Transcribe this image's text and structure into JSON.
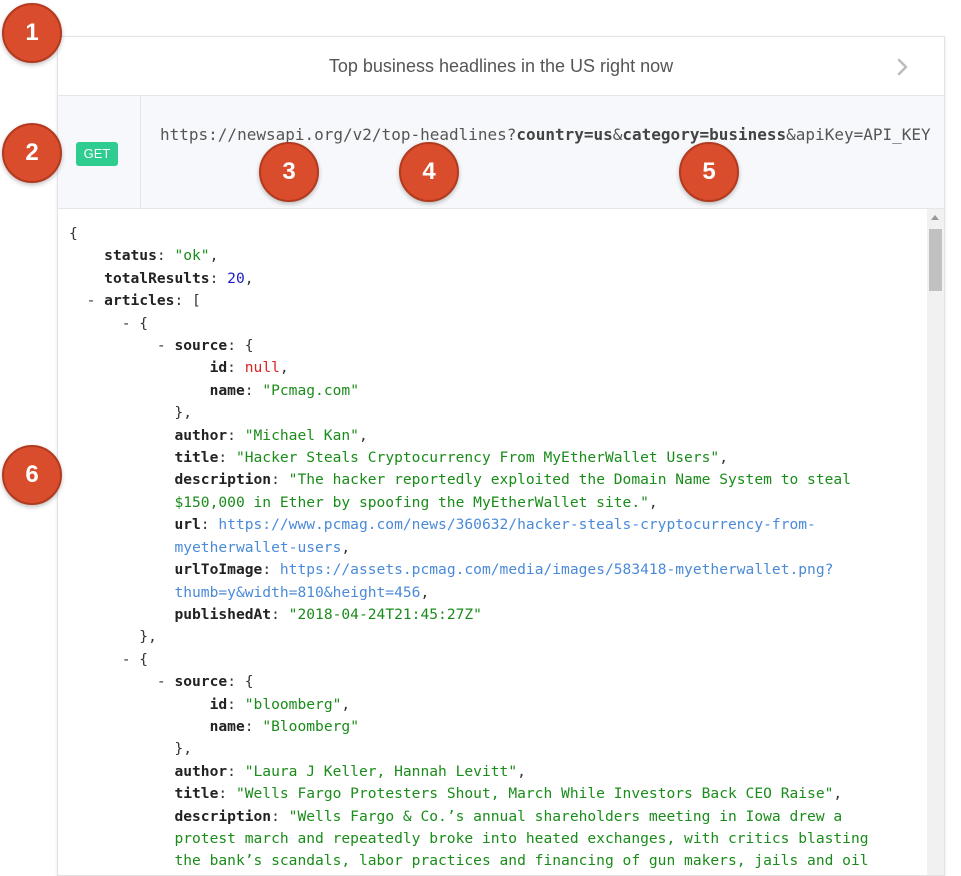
{
  "header": {
    "title": "Top business headlines in the US right now"
  },
  "request": {
    "method": "GET",
    "url_prefix": "https://newsapi.org/v2/top-headlines?",
    "param1": "country=us",
    "amp1": "&",
    "param2": "category=business",
    "url_suffix": "&apiKey=API_KEY"
  },
  "markers": [
    "1",
    "2",
    "3",
    "4",
    "5",
    "6"
  ],
  "json": {
    "open_brace": "{",
    "status_key": "status",
    "status_val": "\"ok\"",
    "total_key": "totalResults",
    "total_val": "20",
    "articles_key": "articles",
    "collapse": "-",
    "a1": {
      "source_key": "source",
      "id_key": "id",
      "id_val": "null",
      "name_key": "name",
      "name_val": "\"Pcmag.com\"",
      "author_key": "author",
      "author_val": "\"Michael Kan\"",
      "title_key": "title",
      "title_val": "\"Hacker Steals Cryptocurrency From MyEtherWallet Users\"",
      "desc_key": "description",
      "desc_line1": "\"The hacker reportedly exploited the Domain Name System to steal",
      "desc_line2": "$150,000 in Ether by spoofing the MyEtherWallet site.\"",
      "url_key": "url",
      "url_line1": "https://www.pcmag.com/news/360632/hacker-steals-cryptocurrency-from-",
      "url_line2": "myetherwallet-users",
      "img_key": "urlToImage",
      "img_line1": "https://assets.pcmag.com/media/images/583418-myetherwallet.png?",
      "img_line2": "thumb=y&width=810&height=456",
      "pub_key": "publishedAt",
      "pub_val": "\"2018-04-24T21:45:27Z\""
    },
    "a2": {
      "source_key": "source",
      "id_key": "id",
      "id_val": "\"bloomberg\"",
      "name_key": "name",
      "name_val": "\"Bloomberg\"",
      "author_key": "author",
      "author_val": "\"Laura J Keller, Hannah Levitt\"",
      "title_key": "title",
      "title_val": "\"Wells Fargo Protesters Shout, March While Investors Back CEO Raise\"",
      "desc_key": "description",
      "desc_line1": "\"Wells Fargo & Co.’s annual shareholders meeting in Iowa drew a",
      "desc_line2": "protest march and repeatedly broke into heated exchanges, with critics blasting",
      "desc_line3": "the bank’s scandals, labor practices and financing of gun makers, jails and oil"
    }
  }
}
